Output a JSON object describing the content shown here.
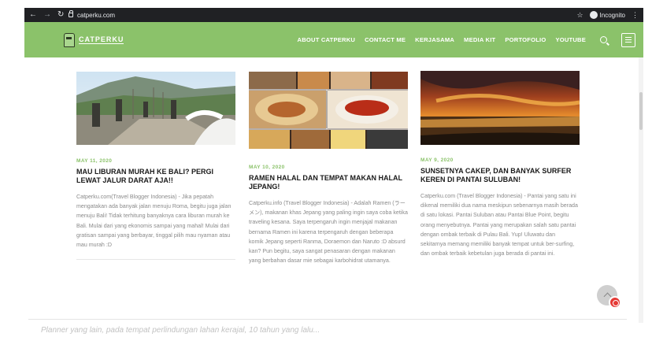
{
  "browser": {
    "url": "catperku.com",
    "incognito_label": "Incognito",
    "icons": [
      "back-arrow-icon",
      "forward-arrow-icon",
      "reload-icon",
      "lock-icon",
      "star-icon",
      "incognito-icon",
      "kebab-menu-icon"
    ]
  },
  "site": {
    "logo_text": "CATPERKU",
    "menu": [
      "ABOUT CATPERKU",
      "CONTACT ME",
      "KERJASAMA",
      "MEDIA KIT",
      "PORTOFOLIO",
      "YOUTUBE"
    ],
    "colors": {
      "header": "#8bc26a",
      "date": "#8bc26a",
      "title": "#1a1a1a",
      "excerpt": "#8a8a8a"
    }
  },
  "posts": [
    {
      "date": "MAY 11, 2020",
      "title": "MAU LIBURAN MURAH KE BALI? PERGI LEWAT JALUR DARAT AJA!!",
      "excerpt": "Catperku.com(Travel Blogger Indonesia) - Jika pepatah mengatakan ada banyak jalan menuju Roma, begitu juga jalan menuju Bali! Tidak terhitung banyaknya cara liburan murah ke Bali. Mulai dari yang ekonomis sampai yang mahal! Mulai dari gratisan sampai yang berbayar, tinggal pilih mau nyaman atau mau murah :D",
      "image": "bali-hill-temple-photo"
    },
    {
      "date": "MAY 10, 2020",
      "title": "RAMEN HALAL DAN TEMPAT MAKAN HALAL JEPANG!",
      "excerpt": "Catperku.info (Travel Blogger Indonesia) - Adalah Ramen (ラーメン), makanan khas Jepang yang paling ingin saya coba ketika traveling kesana. Saya terpengaruh ingin menjajal makanan bernama Ramen ini karena terpengaruh dengan beberapa komik Jepang seperti Ranma, Doraemon dan Naruto :D absurd kan? Pun begitu, saya sangat penasaran dengan makanan yang berbahan dasar mie sebagai karbohidrat utamanya.",
      "image": "ramen-food-collage-photo"
    },
    {
      "date": "MAY 9, 2020",
      "title": "SUNSETNYA CAKEP, DAN BANYAK SURFER KEREN DI PANTAI SULUBAN!",
      "excerpt": "Catperku.com (Travel Blogger Indonesia) - Pantai yang satu ini dikenal memiliki dua nama meskipun sebenarnya masih berada di satu lokasi. Pantai Suluban atau Pantai Blue Point, begitu orang menyebutnya. Pantai yang merupakan salah satu pantai dengan ombak terbaik di Pulau Bali. Yup! Uluwatu dan sekitarnya memang memiliki banyak tempat untuk ber-surfing, dan ombak terbaik kebetulan juga berada di pantai ini.",
      "image": "suluban-sunset-photo"
    }
  ],
  "caption": "Planner yang lain, pada tempat perlindungan lahan kerajal, 10 tahun yang lalu..."
}
